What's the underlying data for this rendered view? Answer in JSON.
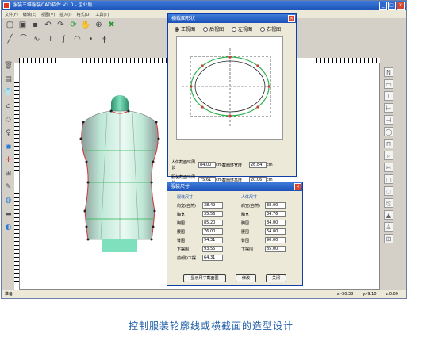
{
  "app": {
    "title": "服装三维服装CAD软件 V1.0 - 企业版",
    "window_buttons": [
      "_",
      "□",
      "×"
    ],
    "menus": [
      "文件(F)",
      "编辑(E)",
      "视图(V)",
      "插入(I)",
      "格式(O)",
      "工具(T)"
    ],
    "status_left": "准备",
    "status_x": "x:-30.38",
    "status_y": "y:-9.10",
    "status_z": "z:0.00"
  },
  "section_dialog": {
    "title": "横截面形状",
    "views": [
      "正视图",
      "后视图",
      "左视图",
      "右视图"
    ],
    "selected_view": "正视图",
    "body_girth_label": "人体截面环周长",
    "body_girth_value": "84.00",
    "garment_girth_label": "服装截面环周长",
    "garment_girth_value": "75.61",
    "unit": "cm",
    "width_label": "截面环宽度",
    "width_value": "26.84",
    "height_label": "截面环高度",
    "height_value": "20.06"
  },
  "size_dialog": {
    "title": "服装尺寸",
    "garment_col_title": "服装尺寸",
    "body_col_title": "人体尺寸",
    "garment_rows": [
      {
        "label": "肩宽(自然)",
        "value": "38.49"
      },
      {
        "label": "胸宽",
        "value": "35.56"
      },
      {
        "label": "胸围",
        "value": "85.20"
      },
      {
        "label": "腰围",
        "value": "76.00"
      },
      {
        "label": "臀围",
        "value": "94.31"
      },
      {
        "label": "下摆围",
        "value": "93.55"
      },
      {
        "label": "前(侧)下摆",
        "value": "64.31"
      }
    ],
    "body_rows": [
      {
        "label": "肩宽(自然)",
        "value": "38.00"
      },
      {
        "label": "胸宽",
        "value": "34.76"
      },
      {
        "label": "胸围",
        "value": "84.00"
      },
      {
        "label": "腰围",
        "value": "64.00"
      },
      {
        "label": "臀围",
        "value": "90.00"
      },
      {
        "label": "下摆围",
        "value": "85.00"
      }
    ],
    "show_section_btn": "显示尺寸截面图",
    "modify_btn": "修改",
    "close_btn": "关闭"
  },
  "caption": "控制服装轮廓线或横截面的造型设计",
  "colors": {
    "title_blue": "#1c52b8",
    "garment_green": "#7fd9b0",
    "outline_red": "#d23b3b",
    "ellipse_green": "#2bb24c",
    "caption_blue": "#1f5ea8"
  }
}
